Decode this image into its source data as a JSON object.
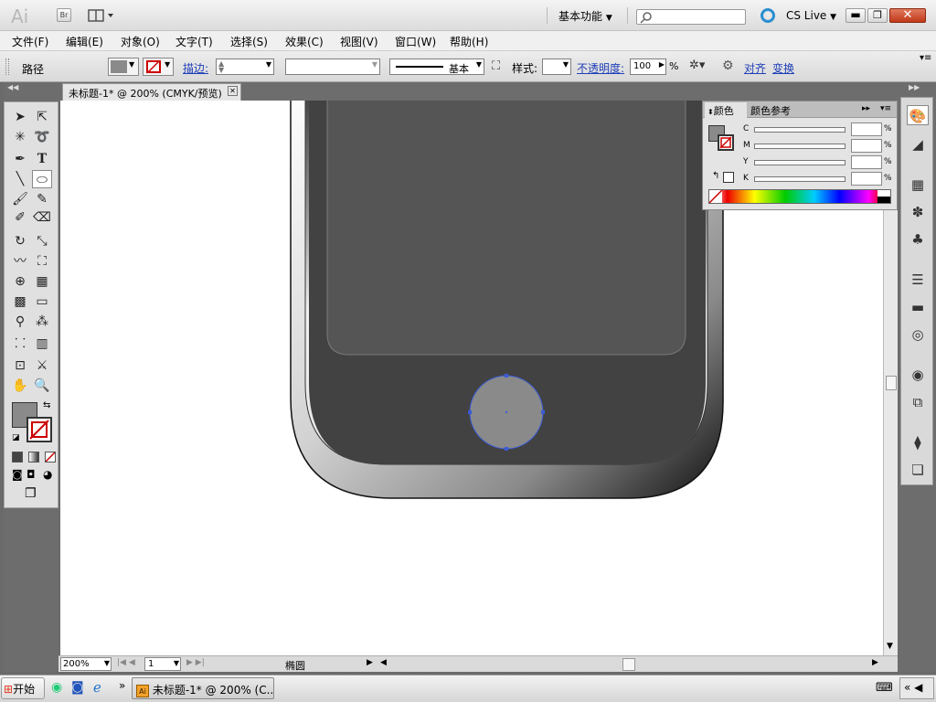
{
  "titlebar": {
    "app_logo": "Ai",
    "bridge_label": "Br",
    "workspace": "基本功能",
    "cs_live": "CS Live"
  },
  "menu": [
    {
      "label": "文件(F)"
    },
    {
      "label": "编辑(E)"
    },
    {
      "label": "对象(O)"
    },
    {
      "label": "文字(T)"
    },
    {
      "label": "选择(S)"
    },
    {
      "label": "效果(C)"
    },
    {
      "label": "视图(V)"
    },
    {
      "label": "窗口(W)"
    },
    {
      "label": "帮助(H)"
    }
  ],
  "control": {
    "selection_type": "路径",
    "stroke_label": "描边:",
    "stroke_profile": "基本",
    "style_label": "样式:",
    "opacity_label": "不透明度:",
    "opacity_value": "100",
    "percent": "%",
    "align_link": "对齐",
    "transform_link": "变换"
  },
  "document": {
    "tab_title": "未标题-1* @ 200% (CMYK/预览)",
    "zoom": "200%",
    "artboard": "1",
    "tool_status": "椭圆"
  },
  "color_panel": {
    "tab_color": "颜色",
    "tab_guide": "颜色参考",
    "channels": [
      {
        "label": "C",
        "unit": "%"
      },
      {
        "label": "M",
        "unit": "%"
      },
      {
        "label": "Y",
        "unit": "%"
      },
      {
        "label": "K",
        "unit": "%"
      }
    ]
  },
  "taskbar": {
    "start": "开始",
    "window_item": "未标题-1* @ 200% (C..."
  },
  "colors": {
    "fill_gray": "#8a8a8a",
    "phone_screen": "#555555",
    "phone_body": "#424242",
    "selection": "#3a5bd6"
  }
}
